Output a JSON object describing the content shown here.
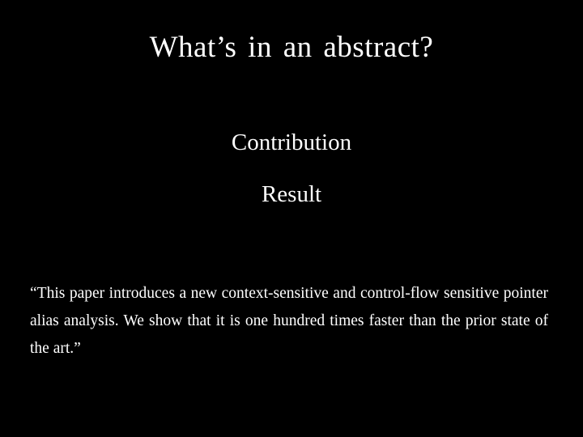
{
  "slide": {
    "title": "What’s in an abstract?",
    "items": [
      {
        "label": "Contribution"
      },
      {
        "label": "Result"
      }
    ],
    "quote": "“This paper introduces a new context-sensitive and control-flow sensitive pointer alias analysis. We show that it is one hundred times faster than the prior state of the art.”",
    "colors": {
      "background": "#000000",
      "text": "#ffffff"
    }
  }
}
